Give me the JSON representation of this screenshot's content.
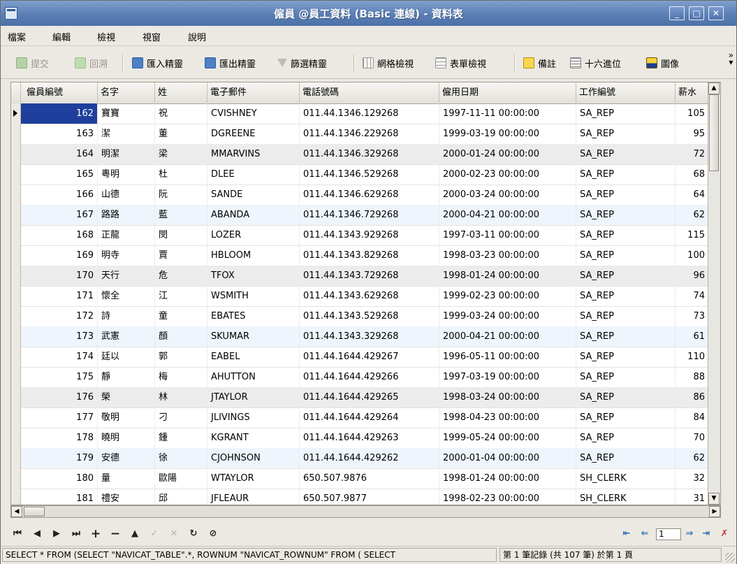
{
  "window": {
    "title": "僱員 @員工資料 (Basic 連線) - 資料表"
  },
  "menu": [
    "檔案",
    "編輯",
    "檢視",
    "視窗",
    "說明"
  ],
  "toolbar": {
    "commit": "提交",
    "rollback": "回溯",
    "import": "匯入精靈",
    "export": "匯出精靈",
    "filter": "篩選精靈",
    "grid_view": "網格檢視",
    "form_view": "表單檢視",
    "memo": "備註",
    "hex": "十六進位",
    "image": "圖像"
  },
  "columns": [
    "僱員編號",
    "名字",
    "姓",
    "電子郵件",
    "電話號碼",
    "僱用日期",
    "工作編號",
    "薪水"
  ],
  "rows": [
    [
      "162",
      "寶寶",
      "祝",
      "CVISHNEY",
      "011.44.1346.129268",
      "1997-11-11 00:00:00",
      "SA_REP",
      "105"
    ],
    [
      "163",
      "潔",
      "董",
      "DGREENE",
      "011.44.1346.229268",
      "1999-03-19 00:00:00",
      "SA_REP",
      "95"
    ],
    [
      "164",
      "明潔",
      "梁",
      "MMARVINS",
      "011.44.1346.329268",
      "2000-01-24 00:00:00",
      "SA_REP",
      "72"
    ],
    [
      "165",
      "粵明",
      "杜",
      "DLEE",
      "011.44.1346.529268",
      "2000-02-23 00:00:00",
      "SA_REP",
      "68"
    ],
    [
      "166",
      "山德",
      "阮",
      "SANDE",
      "011.44.1346.629268",
      "2000-03-24 00:00:00",
      "SA_REP",
      "64"
    ],
    [
      "167",
      "路路",
      "藍",
      "ABANDA",
      "011.44.1346.729268",
      "2000-04-21 00:00:00",
      "SA_REP",
      "62"
    ],
    [
      "168",
      "正龍",
      "閔",
      "LOZER",
      "011.44.1343.929268",
      "1997-03-11 00:00:00",
      "SA_REP",
      "115"
    ],
    [
      "169",
      "明寺",
      "賈",
      "HBLOOM",
      "011.44.1343.829268",
      "1998-03-23 00:00:00",
      "SA_REP",
      "100"
    ],
    [
      "170",
      "天行",
      "危",
      "TFOX",
      "011.44.1343.729268",
      "1998-01-24 00:00:00",
      "SA_REP",
      "96"
    ],
    [
      "171",
      "懷全",
      "江",
      "WSMITH",
      "011.44.1343.629268",
      "1999-02-23 00:00:00",
      "SA_REP",
      "74"
    ],
    [
      "172",
      "詩",
      "童",
      "EBATES",
      "011.44.1343.529268",
      "1999-03-24 00:00:00",
      "SA_REP",
      "73"
    ],
    [
      "173",
      "武憲",
      "顏",
      "SKUMAR",
      "011.44.1343.329268",
      "2000-04-21 00:00:00",
      "SA_REP",
      "61"
    ],
    [
      "174",
      "廷以",
      "郭",
      "EABEL",
      "011.44.1644.429267",
      "1996-05-11 00:00:00",
      "SA_REP",
      "110"
    ],
    [
      "175",
      "靜",
      "梅",
      "AHUTTON",
      "011.44.1644.429266",
      "1997-03-19 00:00:00",
      "SA_REP",
      "88"
    ],
    [
      "176",
      "榮",
      "林",
      "JTAYLOR",
      "011.44.1644.429265",
      "1998-03-24 00:00:00",
      "SA_REP",
      "86"
    ],
    [
      "177",
      "敬明",
      "刁",
      "JLIVINGS",
      "011.44.1644.429264",
      "1998-04-23 00:00:00",
      "SA_REP",
      "84"
    ],
    [
      "178",
      "曉明",
      "鍾",
      "KGRANT",
      "011.44.1644.429263",
      "1999-05-24 00:00:00",
      "SA_REP",
      "70"
    ],
    [
      "179",
      "安德",
      "徐",
      "CJOHNSON",
      "011.44.1644.429262",
      "2000-01-04 00:00:00",
      "SA_REP",
      "62"
    ],
    [
      "180",
      "量",
      "歐陽",
      "WTAYLOR",
      "650.507.9876",
      "1998-01-24 00:00:00",
      "SH_CLERK",
      "32"
    ],
    [
      "181",
      "禮安",
      "邱",
      "JFLEAUR",
      "650.507.9877",
      "1998-02-23 00:00:00",
      "SH_CLERK",
      "31"
    ]
  ],
  "row_styles": [
    "",
    "",
    "grey",
    "",
    "",
    "alt",
    "",
    "",
    "grey",
    "",
    "",
    "alt",
    "",
    "",
    "grey",
    "",
    "",
    "alt",
    "",
    ""
  ],
  "navigation": {
    "page": "1"
  },
  "status": {
    "sql": "SELECT * FROM (SELECT \"NAVICAT_TABLE\".*, ROWNUM \"NAVICAT_ROWNUM\" FROM ( SELECT",
    "record": "第 1 筆記錄 (共 107 筆) 於第 1 頁"
  },
  "colors": {
    "title_bar": "#5b7fb5",
    "selection": "#1f3f9c",
    "alt_row": "#eef5fc"
  }
}
